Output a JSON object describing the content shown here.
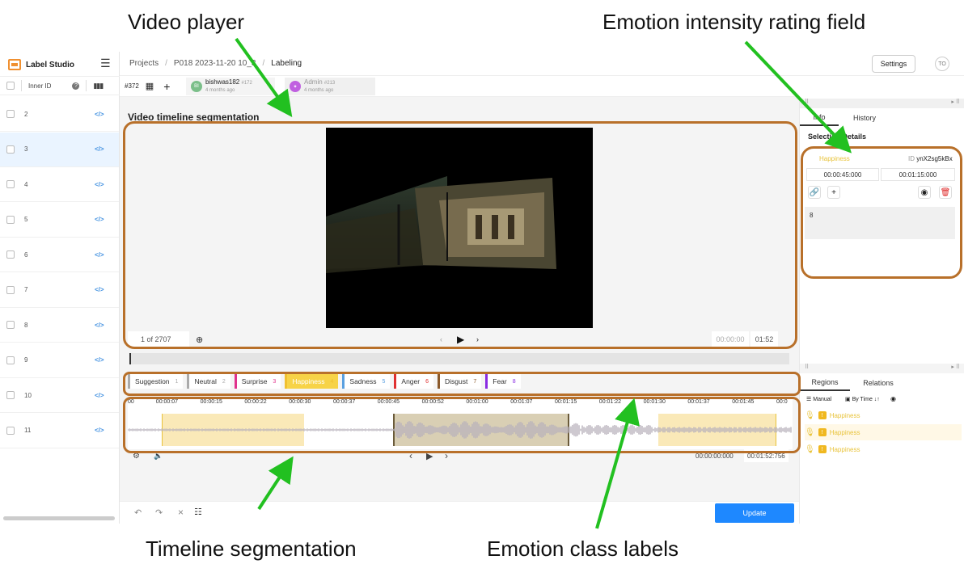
{
  "callouts": {
    "video_player": "Video player",
    "emotion_intensity": "Emotion intensity rating field",
    "timeline_segmentation": "Timeline segmentation",
    "emotion_class_labels": "Emotion class labels"
  },
  "sidebar": {
    "brand": "Label Studio",
    "column_header": "Inner ID",
    "rows": [
      "2",
      "3",
      "4",
      "5",
      "6",
      "7",
      "8",
      "9",
      "10",
      "11"
    ]
  },
  "topbar": {
    "breadcrumb_projects": "Projects",
    "breadcrumb_sep1": "/",
    "breadcrumb_project": "P018 2023-11-20 10_3",
    "breadcrumb_sep2": "/",
    "breadcrumb_page": "Labeling",
    "settings": "Settings",
    "avatar": "TO"
  },
  "annotations_row": {
    "task_id": "#372",
    "ann1_name": "bishwas182",
    "ann1_id": "#172",
    "ann1_time": "4 months ago",
    "ann1_avatar": "BI",
    "ann2_name": "Admin",
    "ann2_id": "#213",
    "ann2_time": "4 months ago"
  },
  "main": {
    "title": "Video timeline segmentation",
    "frame_current": "1",
    "frame_total": "of 2707",
    "time_current": "00:00:00",
    "time_total": "01:52"
  },
  "labels": [
    {
      "name": "Suggestion",
      "key": "1",
      "color": "#aaaaaa",
      "bg": "#ffffff"
    },
    {
      "name": "Neutral",
      "key": "2",
      "color": "#aaaaaa",
      "bg": "#ffffff"
    },
    {
      "name": "Surprise",
      "key": "3",
      "color": "#e0328c",
      "bg": "#ffffff"
    },
    {
      "name": "Happiness",
      "key": "4",
      "color": "#f0c030",
      "bg": "#f7d347"
    },
    {
      "name": "Sadness",
      "key": "5",
      "color": "#5aa0e0",
      "bg": "#ffffff"
    },
    {
      "name": "Anger",
      "key": "6",
      "color": "#e03030",
      "bg": "#ffffff"
    },
    {
      "name": "Disgust",
      "key": "7",
      "color": "#8b5a2b",
      "bg": "#ffffff"
    },
    {
      "name": "Fear",
      "key": "8",
      "color": "#8a2be2",
      "bg": "#ffffff"
    }
  ],
  "timeline": {
    "ticks": [
      "00",
      "00:00:07",
      "00:00:15",
      "00:00:22",
      "00:00:30",
      "00:00:37",
      "00:00:45",
      "00:00:52",
      "00:01:00",
      "00:01:07",
      "00:01:15",
      "00:01:22",
      "00:01:30",
      "00:01:37",
      "00:01:45",
      "00:0"
    ],
    "time_current": "00:00:00:000",
    "time_total": "00:01:52:756"
  },
  "bottom": {
    "update": "Update"
  },
  "right": {
    "tab_info": "Info",
    "tab_history": "History",
    "selection_title": "Selection Details",
    "region_label": "Happiness",
    "region_id_prefix": "ID",
    "region_id": "ynX2sg5kBx",
    "start": "00:00:45:000",
    "end": "00:01:15:000",
    "rating_value": "8",
    "tab_regions": "Regions",
    "tab_relations": "Relations",
    "sort_manual": "Manual",
    "sort_by_time": "By Time",
    "regions": [
      "Happiness",
      "Happiness",
      "Happiness"
    ]
  }
}
